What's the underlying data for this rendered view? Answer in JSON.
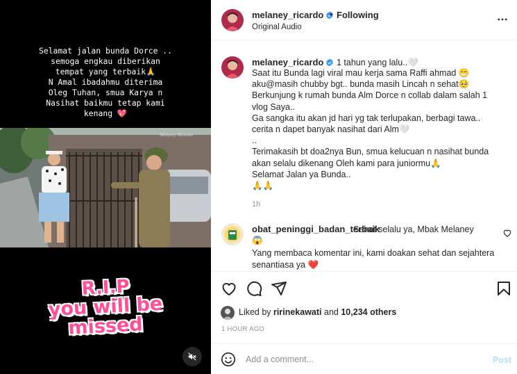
{
  "media": {
    "caption": "Selamat jalan bunda Dorce ..\nsemoga engkau diberikan\ntempat yang terbaik🙏\nN Amal ibadahmu diterima\nOleg Tuhan, smua Karya n\nNasihat baikmu tetap kami\nkenang 💖",
    "watermark": "Melaney Ricardo",
    "sticker": {
      "line1": "R.I.P",
      "line2": "you will be",
      "line3": "missed"
    },
    "mute_icon": "speaker-muted-icon"
  },
  "header": {
    "username": "melaney_ricardo",
    "separator": "•",
    "follow_state": "Following",
    "audio": "Original Audio",
    "more_icon": "more-horizontal-icon"
  },
  "caption_comment": {
    "username": "melaney_ricardo",
    "inline_text": "1 tahun yang lalu..🤍",
    "body": "Saat itu Bunda lagi viral mau kerja sama Raffi ahmad 😁\naku@masih chubby bgt.. bunda masih Lincah n sehat🥺\nBerkunjung k rumah bunda Alm Dorce n collab dalam salah 1 vlog Saya..\nGa sangka itu akan jd hari yg tak terlupakan, berbagi tawa.. cerita n dapet banyak nasihat dari Alm🤍\n..\nTerimakasih bt doa2nya Bun, smua kelucuan n nasihat bunda akan selalu dikenang Oleh kami para juniormu🙏\nSelamat Jalan ya Bunda..\n🙏🙏",
    "age": "1h"
  },
  "comment2": {
    "username": "obat_peninggi_badan_terbaik",
    "text": "Sehat selalu ya, Mbak Melaney",
    "emoji": "😱",
    "reply": "Yang membaca komentar ini, kami doakan sehat dan sejahtera senantiasa ya ❤️"
  },
  "actions": {
    "liked_by_prefix": "Liked by",
    "liked_by_user": "ririnekawati",
    "liked_by_and": "and",
    "liked_by_count": "10,234 others",
    "post_age": "1 HOUR AGO"
  },
  "add_comment": {
    "placeholder": "Add a comment...",
    "post_label": "Post"
  },
  "colors": {
    "accent_blue": "#0095f6",
    "post_disabled": "#b2dffc",
    "heart_red": "#ed4956",
    "verified_blue": "#3897f0"
  }
}
